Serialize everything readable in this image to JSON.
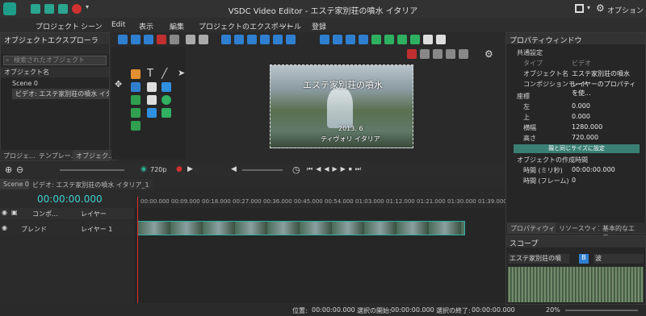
{
  "window": {
    "title": "VSDC Video Editor - エステ家別荘の噴水 イタリア"
  },
  "titlebar": {
    "options_label": "オプション"
  },
  "menu": [
    "プロジェクト",
    "シーン",
    "Edit",
    "表示",
    "編集",
    "プロジェクトのエクスポート",
    "ツール",
    "登録"
  ],
  "explorer": {
    "title": "オブジェクトエクスプローラ",
    "search_placeholder": "検索されたオブジェクト",
    "header": "オブジェクト名",
    "items": [
      "Scene 0",
      "ビデオ: エステ家別荘の噴水 イタリア"
    ],
    "tabs": [
      "プロジェ...",
      "テンプレー...",
      "オブジェク..."
    ]
  },
  "preview": {
    "overlay_title": "エステ家別荘の噴水",
    "overlay_date": "2013. 6",
    "overlay_sub": "ティヴォリ イタリア"
  },
  "playback": {
    "resolution": "720p"
  },
  "timeline": {
    "tabs": [
      "Scene 0",
      "ビデオ: エステ家別荘の噴水 イタリア_1"
    ],
    "timecode": "00:00:00.000",
    "ruler": [
      "00:00.000",
      "00:09.000",
      "00:18.000",
      "00:27.000",
      "00:36.000",
      "00:45.000",
      "00:54.000",
      "01:03.000",
      "01:12.000",
      "01:21.000",
      "01:30.000",
      "01:39.000"
    ],
    "track1": {
      "name": "コンポ...",
      "layer": "レイヤー"
    },
    "track2": {
      "name": "ブレンド",
      "layer": "レイヤー 1"
    }
  },
  "properties": {
    "title": "プロパティウィンドウ",
    "type_key": "タイプ",
    "type_val": "ビデオ",
    "section_common": "共通設定",
    "rows": [
      {
        "k": "オブジェクト名",
        "v": "エステ家別荘の噴水"
      },
      {
        "k": "コンポジションモード",
        "v": "レイヤーのプロパティを使..."
      }
    ],
    "section_coords": "座標",
    "coords": [
      {
        "k": "左",
        "v": "0.000"
      },
      {
        "k": "上",
        "v": "0.000"
      },
      {
        "k": "横幅",
        "v": "1280.000"
      },
      {
        "k": "高さ",
        "v": "720.000"
      }
    ],
    "same_size_button": "親と同じサイズに設定",
    "section_time": "オブジェクトの作成時間",
    "time_rows": [
      {
        "k": "時間 (ミリ秒)",
        "v": "00:00:00.000"
      },
      {
        "k": "時間 (フレーム)",
        "v": "0"
      }
    ],
    "tabs": [
      "プロパティウィ...",
      "リソースウィンドウ",
      "基本的なエフ..."
    ]
  },
  "scope": {
    "title": "スコープ",
    "source": "エステ家別荘の噴",
    "channel": "B",
    "mode": "波"
  },
  "status": {
    "position_label": "位置:",
    "position": "00:00:00.000",
    "sel_start_label": "選択の開始:",
    "sel_start": "00:00:00.000",
    "sel_end_label": "選択の終了:",
    "sel_end": "00:00:00.000",
    "zoom": "20%"
  }
}
